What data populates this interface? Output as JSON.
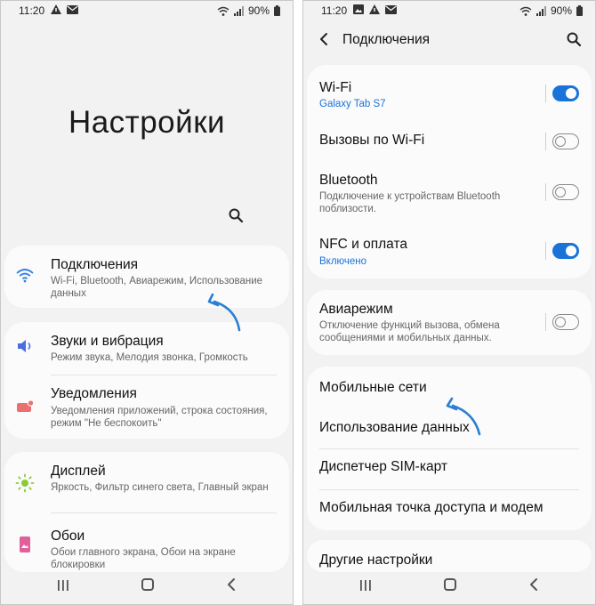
{
  "left": {
    "status": {
      "time": "11:20",
      "battery": "90%"
    },
    "title": "Настройки",
    "items": [
      {
        "title": "Подключения",
        "subtitle": "Wi-Fi, Bluetooth, Авиарежим, Использование данных",
        "icon": "wifi-icon"
      },
      {
        "title": "Звуки и вибрация",
        "subtitle": "Режим звука, Мелодия звонка, Громкость",
        "icon": "volume-icon"
      },
      {
        "title": "Уведомления",
        "subtitle": "Уведомления приложений, строка состояния, режим \"Не беспокоить\"",
        "icon": "notification-icon"
      },
      {
        "title": "Дисплей",
        "subtitle": "Яркость, Фильтр синего света, Главный экран",
        "icon": "brightness-icon"
      },
      {
        "title": "Обои",
        "subtitle": "Обои главного экрана, Обои на экране блокировки",
        "icon": "wallpaper-icon"
      }
    ]
  },
  "right": {
    "status": {
      "time": "11:20",
      "battery": "90%"
    },
    "header": "Подключения",
    "toggles": [
      {
        "title": "Wi-Fi",
        "accent": "Galaxy Tab S7",
        "on": true
      },
      {
        "title": "Вызовы по Wi-Fi",
        "on": false
      },
      {
        "title": "Bluetooth",
        "subtitle": "Подключение к устройствам Bluetooth поблизости.",
        "on": false
      },
      {
        "title": "NFC и оплата",
        "accent": "Включено",
        "on": true
      }
    ],
    "airplane": {
      "title": "Авиарежим",
      "subtitle": "Отключение функций вызова, обмена сообщениями и мобильных данных.",
      "on": false
    },
    "links": [
      "Мобильные сети",
      "Использование данных",
      "Диспетчер SIM-карт",
      "Мобильная точка доступа и модем"
    ],
    "more": "Другие настройки"
  },
  "colors": {
    "accent": "#1a73d9",
    "background": "#f2f2f2",
    "card": "#fbfbfb"
  }
}
